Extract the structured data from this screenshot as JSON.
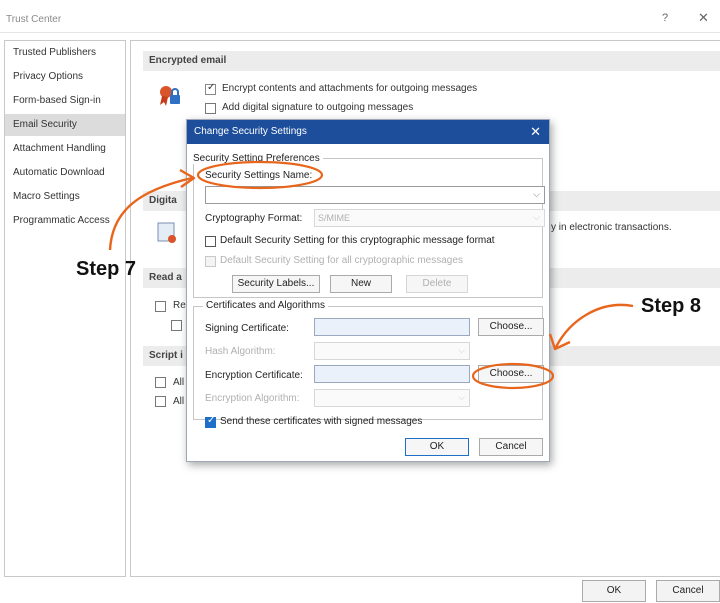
{
  "window": {
    "title": "Trust Center",
    "help": "?",
    "close": "✕"
  },
  "sidebar": {
    "items": [
      {
        "label": "Trusted Publishers"
      },
      {
        "label": "Privacy Options"
      },
      {
        "label": "Form-based Sign-in"
      },
      {
        "label": "Email Security",
        "selected": true
      },
      {
        "label": "Attachment Handling"
      },
      {
        "label": "Automatic Download"
      },
      {
        "label": "Macro Settings"
      },
      {
        "label": "Programmatic Access"
      }
    ]
  },
  "main": {
    "encrypted_email": {
      "heading": "Encrypted email",
      "encrypt_label": "Encrypt contents and attachments for outgoing messages",
      "encrypt_checked": true,
      "signature_label": "Add digital signature to outgoing messages",
      "signature_checked": false
    },
    "digital_ids": {
      "heading_fragment": "Digita",
      "text_fragment": "y in electronic transactions."
    },
    "read": {
      "heading_fragment": "Read a",
      "item_fragment": "Re"
    },
    "script": {
      "heading_fragment": "Script i",
      "item1_fragment": "All",
      "item2_fragment": "All"
    }
  },
  "footer": {
    "ok": "OK",
    "cancel": "Cancel"
  },
  "dialog": {
    "title": "Change Security Settings",
    "close": "✕",
    "group_preferences": "Security Setting Preferences",
    "name_label": "Security Settings Name:",
    "name_value": "",
    "crypto_format_label": "Cryptography Format:",
    "crypto_format_value": "S/MIME",
    "default_format_label": "Default Security Setting for this cryptographic message format",
    "default_all_label": "Default Security Setting for all cryptographic messages",
    "security_labels_btn": "Security Labels...",
    "new_btn": "New",
    "delete_btn": "Delete",
    "group_certificates": "Certificates and Algorithms",
    "signing_cert_label": "Signing Certificate:",
    "choose_signing_btn": "Choose...",
    "hash_algorithm_label": "Hash Algorithm:",
    "encryption_cert_label": "Encryption Certificate:",
    "choose_encryption_btn": "Choose...",
    "encryption_algorithm_label": "Encryption Algorithm:",
    "send_certs_label": "Send these certificates with signed messages",
    "send_certs_checked": true,
    "ok": "OK",
    "cancel": "Cancel"
  },
  "annotations": {
    "step7": "Step 7",
    "step8": "Step 8",
    "color": "#e8651c"
  }
}
